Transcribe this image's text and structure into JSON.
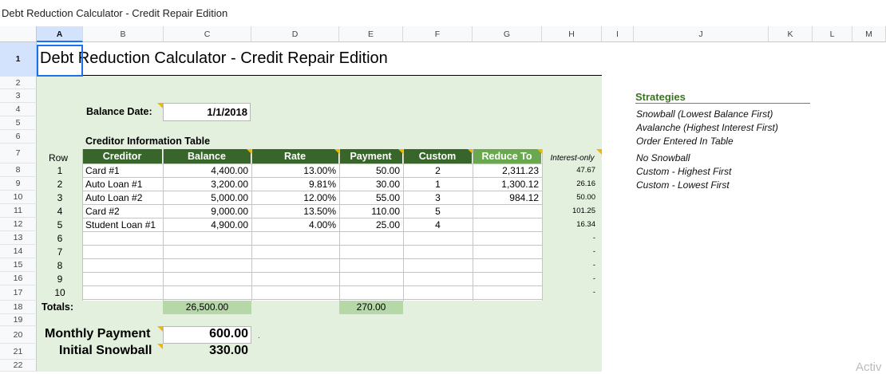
{
  "window": {
    "title": "Debt Reduction Calculator - Credit Repair Edition"
  },
  "columns": [
    "A",
    "B",
    "C",
    "D",
    "E",
    "F",
    "G",
    "H",
    "I",
    "J",
    "K",
    "L",
    "M"
  ],
  "rows": [
    "1",
    "2",
    "3",
    "4",
    "5",
    "6",
    "7",
    "8",
    "9",
    "10",
    "11",
    "12",
    "13",
    "14",
    "15",
    "16",
    "17",
    "18",
    "19",
    "20",
    "21",
    "22"
  ],
  "sheet": {
    "title": "Debt Reduction Calculator - Credit Repair Edition",
    "balance_date_label": "Balance Date:",
    "balance_date": "1/1/2018",
    "table_title": "Creditor Information Table",
    "row_label": "Row",
    "headers": {
      "creditor": "Creditor",
      "balance": "Balance",
      "rate": "Rate",
      "payment": "Payment",
      "custom": "Custom",
      "reduce": "Reduce To",
      "interest": "Interest-only"
    },
    "rows": [
      {
        "n": "1",
        "creditor": "Card #1",
        "balance": "4,400.00",
        "rate": "13.00%",
        "payment": "50.00",
        "custom": "2",
        "reduce": "2,311.23",
        "interest": "47.67"
      },
      {
        "n": "2",
        "creditor": "Auto Loan #1",
        "balance": "3,200.00",
        "rate": "9.81%",
        "payment": "30.00",
        "custom": "1",
        "reduce": "1,300.12",
        "interest": "26.16"
      },
      {
        "n": "3",
        "creditor": "Auto Loan #2",
        "balance": "5,000.00",
        "rate": "12.00%",
        "payment": "55.00",
        "custom": "3",
        "reduce": "984.12",
        "interest": "50.00"
      },
      {
        "n": "4",
        "creditor": "Card #2",
        "balance": "9,000.00",
        "rate": "13.50%",
        "payment": "110.00",
        "custom": "5",
        "reduce": "",
        "interest": "101.25"
      },
      {
        "n": "5",
        "creditor": "Student Loan #1",
        "balance": "4,900.00",
        "rate": "4.00%",
        "payment": "25.00",
        "custom": "4",
        "reduce": "",
        "interest": "16.34"
      },
      {
        "n": "6",
        "creditor": "",
        "balance": "",
        "rate": "",
        "payment": "",
        "custom": "",
        "reduce": "",
        "interest": "-"
      },
      {
        "n": "7",
        "creditor": "",
        "balance": "",
        "rate": "",
        "payment": "",
        "custom": "",
        "reduce": "",
        "interest": "-"
      },
      {
        "n": "8",
        "creditor": "",
        "balance": "",
        "rate": "",
        "payment": "",
        "custom": "",
        "reduce": "",
        "interest": "-"
      },
      {
        "n": "9",
        "creditor": "",
        "balance": "",
        "rate": "",
        "payment": "",
        "custom": "",
        "reduce": "",
        "interest": "-"
      },
      {
        "n": "10",
        "creditor": "",
        "balance": "",
        "rate": "",
        "payment": "",
        "custom": "",
        "reduce": "",
        "interest": "-"
      }
    ],
    "totals_label": "Totals:",
    "total_balance": "26,500.00",
    "total_payment": "270.00",
    "monthly_payment_label": "Monthly Payment",
    "monthly_payment": "600.00",
    "initial_snowball_label": "Initial Snowball",
    "initial_snowball": "330.00"
  },
  "strategies": {
    "title": "Strategies",
    "items": [
      "Snowball (Lowest Balance First)",
      "Avalanche (Highest Interest First)",
      "Order Entered In Table",
      "No Snowball",
      "Custom - Highest First",
      "Custom - Lowest First"
    ]
  },
  "watermark": "Activ",
  "colors": {
    "header_green": "#38662a",
    "reduce_green": "#6aa84f",
    "bg_green": "#e3f0dd",
    "total_green": "#b6d7a8",
    "strategy_title": "#38761d",
    "note_triangle": "#f5b400",
    "selection": "#1a73e8"
  }
}
